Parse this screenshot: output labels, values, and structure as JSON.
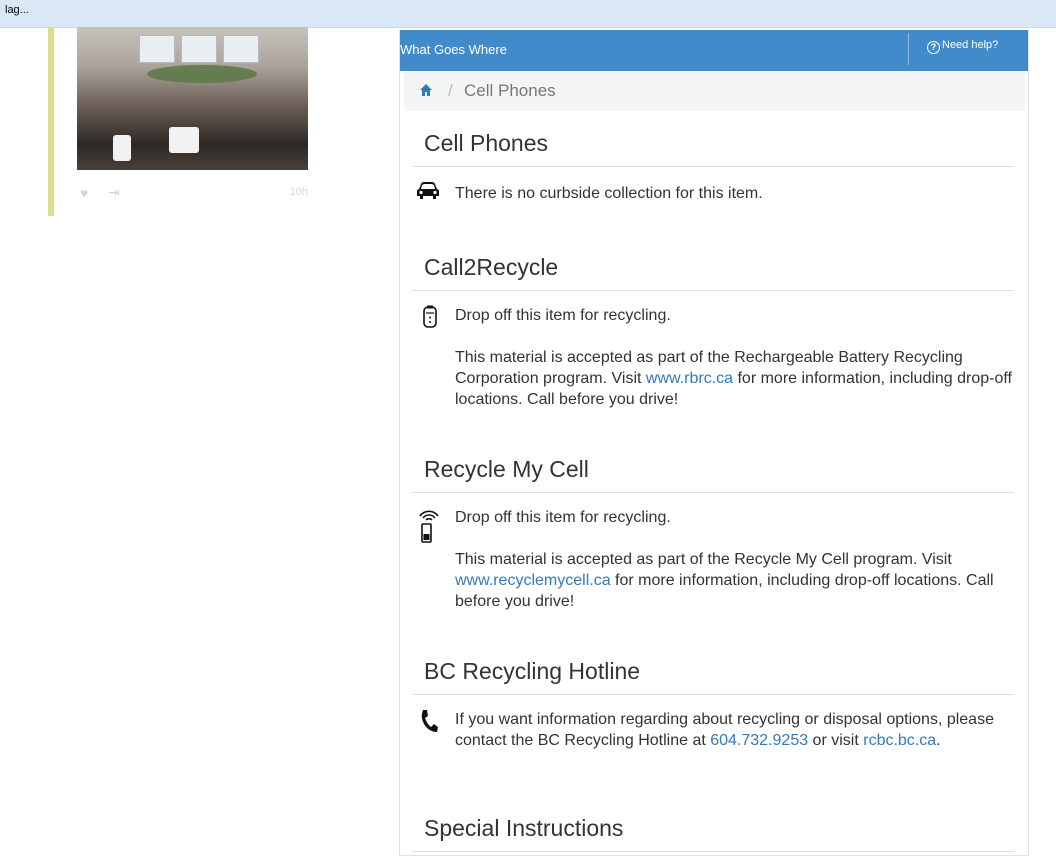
{
  "browser": {
    "status_text": "lag..."
  },
  "feed": {
    "timestamp": "10h"
  },
  "panel": {
    "header_title": "What Goes Where",
    "help_label": "Need help?",
    "breadcrumb_current": "Cell Phones",
    "colors": {
      "header": "#428bca",
      "link": "#337ab7"
    }
  },
  "sections": {
    "cell_phones": {
      "title": "Cell Phones",
      "text": "There is no curbside collection for this item.",
      "icon": "car-icon"
    },
    "call2recycle": {
      "title": "Call2Recycle",
      "line1": "Drop off this item for recycling.",
      "p_before": "This material is accepted as part of the Rechargeable Battery Recycling Corporation program. Visit ",
      "link": "www.rbrc.ca",
      "p_after": " for more information, including drop-off locations. Call before you drive!",
      "icon": "battery-icon"
    },
    "recycle_my_cell": {
      "title": "Recycle My Cell",
      "line1": "Drop off this item for recycling.",
      "p_before": "This material is accepted as part of the Recycle My Cell program. Visit ",
      "link": "www.recyclemycell.ca",
      "p_after": " for more information, including drop-off locations. Call before you drive!",
      "icon": "cell-signal-icon"
    },
    "bc_hotline": {
      "title": "BC Recycling Hotline",
      "p_before": "If you want information regarding about recycling or disposal options, please contact the BC Recycling Hotline at ",
      "phone": "604.732.9253",
      "p_mid": " or visit ",
      "link": "rcbc.bc.ca",
      "p_after": ".",
      "icon": "phone-icon"
    },
    "special": {
      "title": "Special Instructions"
    }
  }
}
